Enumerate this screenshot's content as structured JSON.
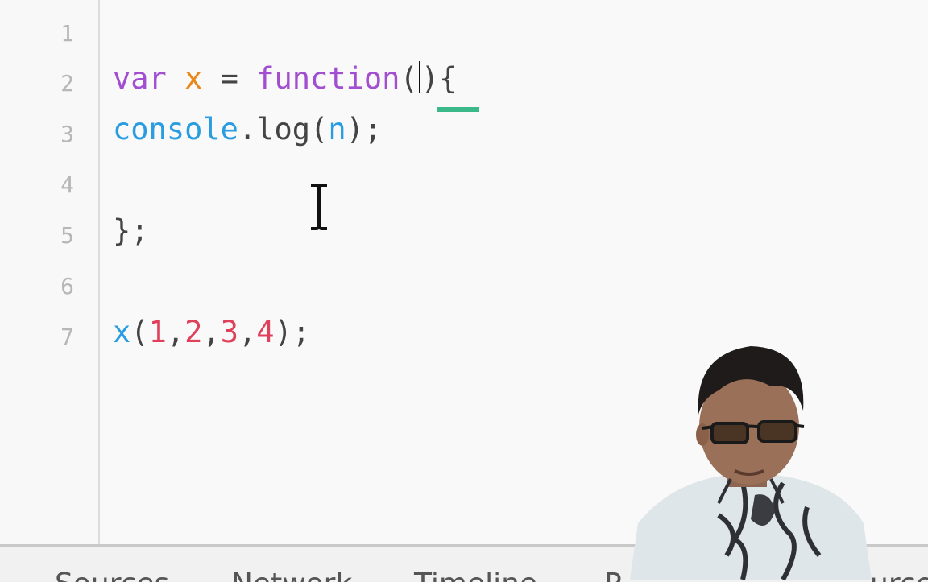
{
  "editor": {
    "line_numbers": [
      "1",
      "2",
      "3",
      "4",
      "5",
      "6",
      "7"
    ],
    "line2": {
      "kw_var": "var",
      "name": "x",
      "eq": "=",
      "kw_function": "function",
      "open_paren": "(",
      "close_paren_brace": "){"
    },
    "line3": {
      "obj": "console",
      "rest": ".log(",
      "arg": "n",
      "end": ");"
    },
    "line5": {
      "text": "};"
    },
    "line7": {
      "fn": "x",
      "open": "(",
      "n1": "1",
      "c1": ",",
      "n2": "2",
      "c2": ",",
      "n3": "3",
      "c3": ",",
      "n4": "4",
      "end": ");"
    }
  },
  "devtools_tabs": [
    "Sources",
    "Network",
    "Timeline",
    "P",
    "urces"
  ],
  "colors": {
    "keyword": "#a14fd0",
    "variable": "#e8881b",
    "identifier": "#2a9de0",
    "number": "#e0405a",
    "match_underline": "#3bb98b"
  },
  "icons": [
    "text-cursor-icon"
  ]
}
